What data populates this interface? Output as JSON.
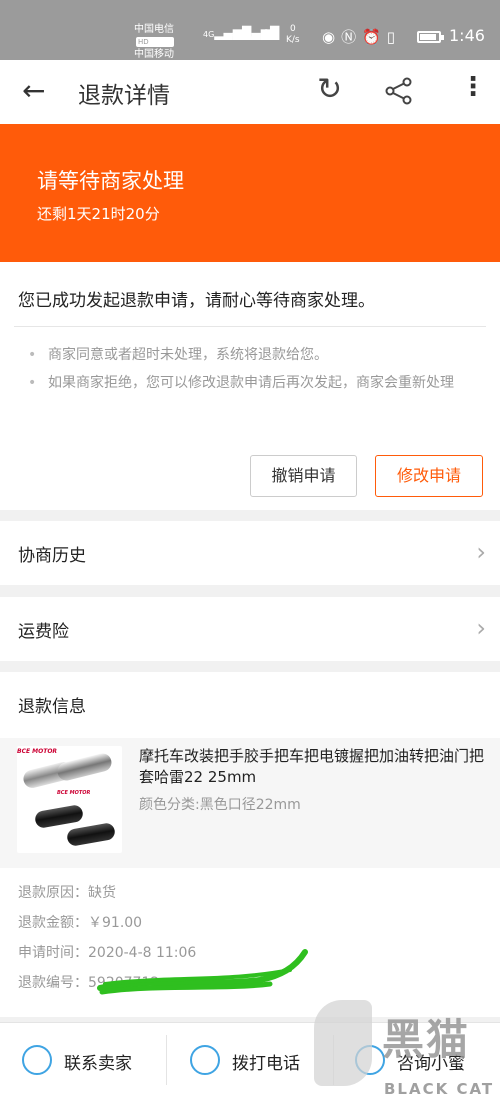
{
  "statusbar": {
    "carrier1": "中国电信",
    "carrier2": "中国移动",
    "hd": "HD",
    "net1": "4G",
    "net2": "4G",
    "speed_value": "0",
    "speed_unit": "K/s",
    "time": "1:46"
  },
  "appbar": {
    "title": "退款详情"
  },
  "banner": {
    "status": "请等待商家处理",
    "remaining": "还剩1天21时20分"
  },
  "status_card": {
    "headline": "您已成功发起退款申请，请耐心等待商家处理。",
    "tips": [
      "商家同意或者超时未处理，系统将退款给您。",
      "如果商家拒绝，您可以修改退款申请后再次发起，商家会重新处理"
    ],
    "cancel_label": "撤销申请",
    "modify_label": "修改申请"
  },
  "rows": {
    "history": "协商历史",
    "shipping_insurance": "运费险"
  },
  "refund_info": {
    "title": "退款信息",
    "product": {
      "brand": "BCE MOTOR",
      "name": "摩托车改装把手胶手把车把电镀握把加油转把油门把套哈雷22 25mm",
      "spec": "颜色分类:黑色口径22mm"
    },
    "reason_label": "退款原因：",
    "reason": "缺货",
    "amount_label": "退款金额：",
    "amount": "￥91.00",
    "time_label": "申请时间：",
    "time": "2020-4-8 11:06",
    "number_label": "退款编号：",
    "number": "59207712"
  },
  "bottombar": {
    "contact_seller": "联系卖家",
    "call": "拨打电话",
    "consult": "咨询小蜜"
  },
  "watermark": {
    "cn": "黑猫",
    "en": "BLACK CAT"
  },
  "colors": {
    "accent": "#ff5b0a",
    "icon_blue": "#3fa4e3",
    "scribble_green": "#2fbf1f"
  }
}
